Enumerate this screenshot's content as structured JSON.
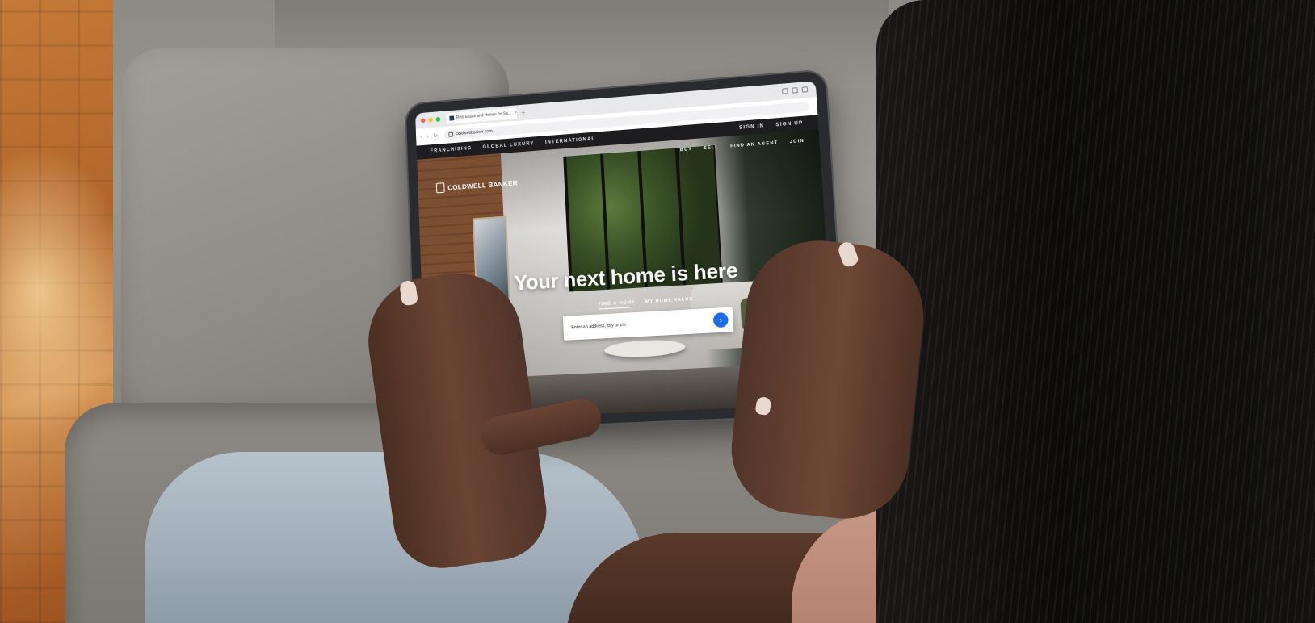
{
  "browser": {
    "tab_title": "Real Estate and Homes for Sa...",
    "tab_close": "×",
    "new_tab": "+",
    "url": "coldwellbanker.com"
  },
  "site": {
    "topbar_left": [
      "FRANCHISING",
      "GLOBAL LUXURY",
      "INTERNATIONAL"
    ],
    "topbar_right": [
      "SIGN IN",
      "SIGN UP"
    ],
    "nav": [
      "BUY",
      "SELL",
      "FIND AN AGENT",
      "JOIN"
    ],
    "logo_text": "COLDWELL BANKER",
    "headline": "Your next home is here",
    "search_tabs": [
      "FIND A HOME",
      "MY HOME VALUE"
    ],
    "search_placeholder": "Enter an address, city or zip",
    "search_button": "›",
    "accent_color": "#1a6ce8"
  }
}
